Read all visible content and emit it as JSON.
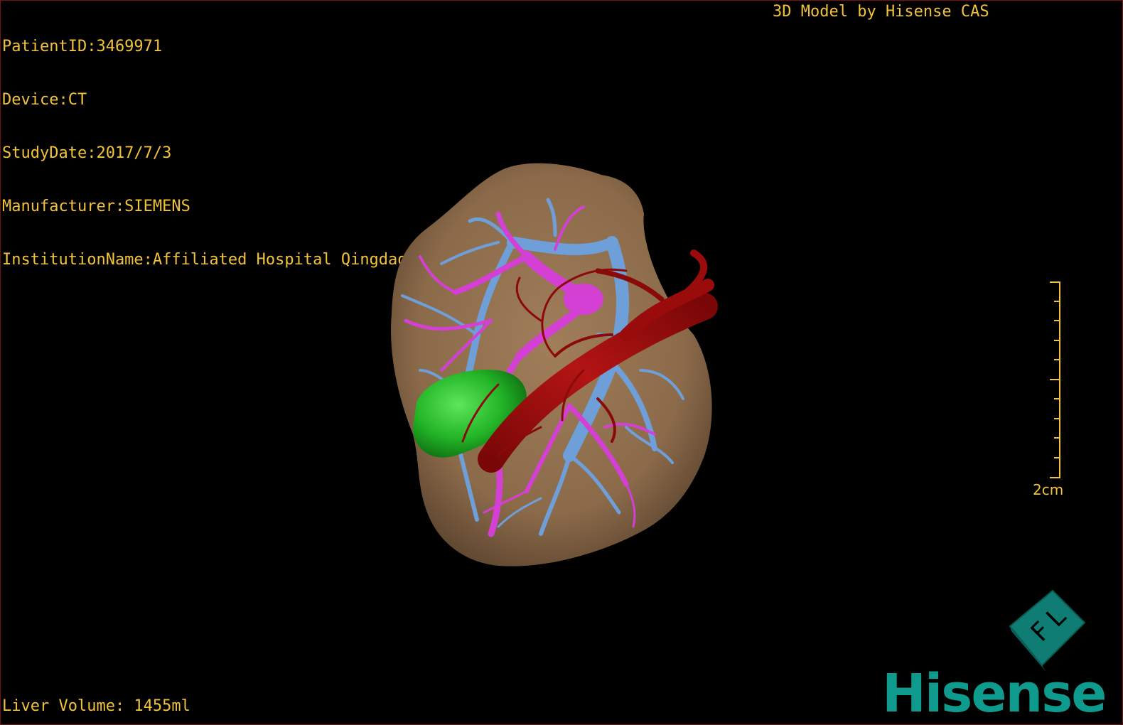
{
  "header": {
    "patient_id": "PatientID:3469971",
    "device": "Device:CT",
    "study_date": "StudyDate:2017/7/3",
    "manufacturer": "Manufacturer:SIEMENS",
    "institution": "InstitutionName:Affiliated Hospital Qingdao University-C"
  },
  "title": "3D Model by Hisense CAS",
  "footer": {
    "liver_volume": "Liver Volume: 1455ml"
  },
  "scale_bar": {
    "label": "2cm"
  },
  "orientation_cube": {
    "face_letters": [
      "F",
      "L"
    ]
  },
  "brand": {
    "name": "Hisense"
  },
  "colors": {
    "text": "#f2c23a",
    "liver": "#8b6a4a",
    "hepatic_vein": "#6f9fd8",
    "portal_vein": "#d43fd4",
    "artery": "#9a0b0b",
    "gallbladder": "#25b828",
    "brand": "#0e9b8e"
  }
}
